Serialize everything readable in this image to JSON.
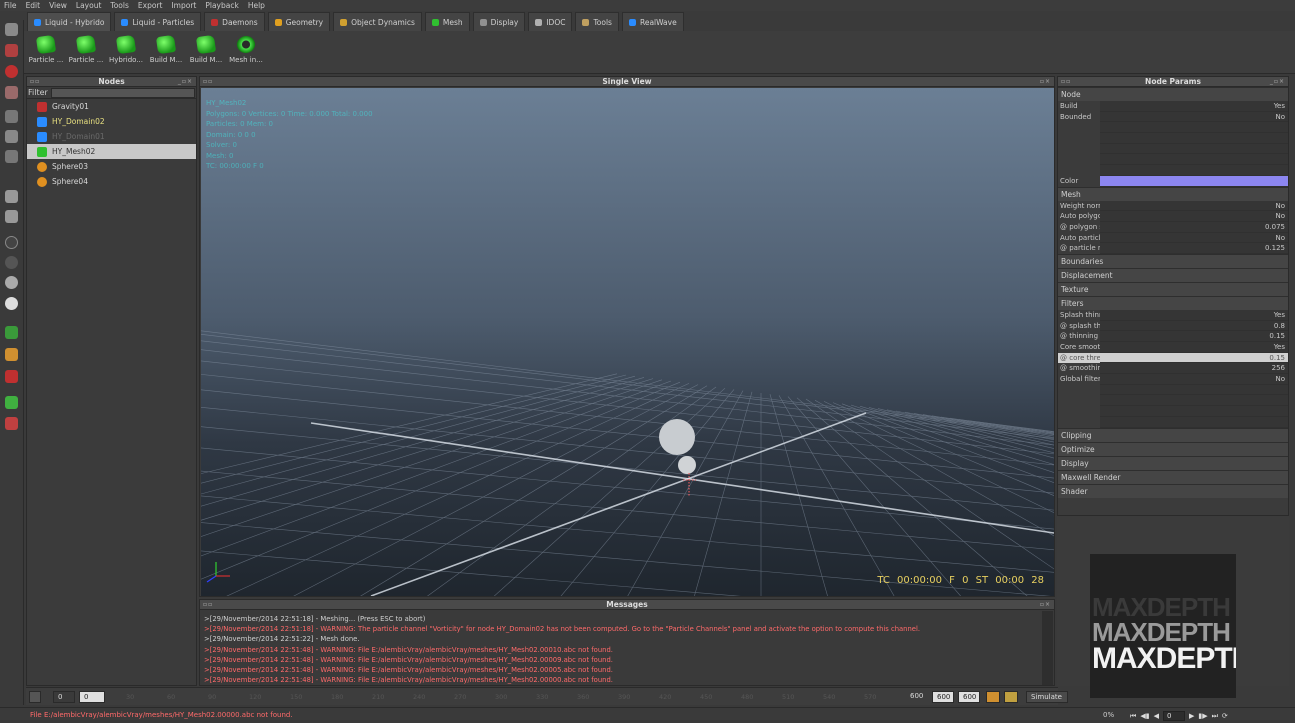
{
  "menu": [
    "File",
    "Edit",
    "View",
    "Layout",
    "Tools",
    "Export",
    "Import",
    "Playback",
    "Help"
  ],
  "tabs": [
    {
      "label": "Liquid - Hybrido",
      "color": "#2a8cff"
    },
    {
      "label": "Liquid - Particles",
      "color": "#2a8cff"
    },
    {
      "label": "Daemons",
      "color": "#c03030"
    },
    {
      "label": "Geometry",
      "color": "#e0a020"
    },
    {
      "label": "Object Dynamics",
      "color": "#d0a030"
    },
    {
      "label": "Mesh",
      "color": "#30c030"
    },
    {
      "label": "Display",
      "color": "#909090"
    },
    {
      "label": "IDOC",
      "color": "#b0b0b0"
    },
    {
      "label": "Tools",
      "color": "#c0a060"
    },
    {
      "label": "RealWave",
      "color": "#2a8cff"
    }
  ],
  "toolbar": [
    "Particle ...",
    "Particle ...",
    "Hybrido...",
    "Build M...",
    "Build M...",
    "Mesh in..."
  ],
  "nodes": {
    "title": "Nodes",
    "filter_label": "Filter",
    "filter_value": "",
    "items": [
      {
        "label": "Gravity01",
        "icon": "gravity-icon",
        "color": "#c03030"
      },
      {
        "label": "HY_Domain02",
        "icon": "domain-icon",
        "color": "#2a8cff"
      },
      {
        "label": "HY_Domain01",
        "icon": "domain-icon",
        "color": "#2a8cff"
      },
      {
        "label": "HY_Mesh02",
        "icon": "mesh-icon",
        "color": "#30c030"
      },
      {
        "label": "Sphere03",
        "icon": "sphere-icon",
        "color": "#e09020"
      },
      {
        "label": "Sphere04",
        "icon": "sphere-icon",
        "color": "#e09020"
      }
    ]
  },
  "view": {
    "title": "Single View",
    "hud": [
      "HY_Mesh02",
      "Polygons: 0 Vertices: 0 Time: 0.000 Total: 0.000",
      "Particles: 0 Mem: 0",
      "Domain: 0  0  0",
      "Solver: 0",
      "Mesh: 0",
      "TC: 00:00:00  F 0"
    ],
    "tc": "TC 00:00:00",
    "frame": "F 0",
    "st": "ST 00:00 28"
  },
  "messages": {
    "title": "Messages",
    "lines": [
      {
        "text": ">[29/November/2014 22:51:18] - Meshing... (Press ESC to abort)",
        "level": "info"
      },
      {
        "text": ">[29/November/2014 22:51:18] - WARNING: The particle channel \"Vorticity\" for node HY_Domain02 has not been computed. Go to the \"Particle Channels\" panel and activate the option to compute this channel.",
        "level": "warn"
      },
      {
        "text": ">[29/November/2014 22:51:22] - Mesh done.",
        "level": "info"
      },
      {
        "text": ">[29/November/2014 22:51:48] - WARNING: File E:/alembicVray/alembicVray/meshes/HY_Mesh02.00010.abc not found.",
        "level": "warn"
      },
      {
        "text": ">[29/November/2014 22:51:48] - WARNING: File E:/alembicVray/alembicVray/meshes/HY_Mesh02.00009.abc not found.",
        "level": "warn"
      },
      {
        "text": ">[29/November/2014 22:51:48] - WARNING: File E:/alembicVray/alembicVray/meshes/HY_Mesh02.00005.abc not found.",
        "level": "warn"
      },
      {
        "text": ">[29/November/2014 22:51:48] - WARNING: File E:/alembicVray/alembicVray/meshes/HY_Mesh02.00000.abc not found.",
        "level": "warn"
      }
    ]
  },
  "params": {
    "title": "Node Params",
    "node_section": "Node",
    "node_rows": [
      {
        "k": "Build",
        "v": "Yes"
      },
      {
        "k": "Bounded",
        "v": "No"
      },
      {
        "k": "",
        "v": "",
        "ghost": true
      },
      {
        "k": "",
        "v": "",
        "ghost": true
      },
      {
        "k": "",
        "v": "",
        "ghost": true
      },
      {
        "k": "",
        "v": "",
        "ghost": true
      },
      {
        "k": "",
        "v": "",
        "ghost": true
      },
      {
        "k": "Color",
        "v": "",
        "color": "#8c86f0"
      }
    ],
    "mesh_section": "Mesh",
    "mesh_rows": [
      {
        "k": "Weight normalization",
        "v": "No"
      },
      {
        "k": "Auto polygon size",
        "v": "No"
      },
      {
        "k": "@ polygon size",
        "v": "0.075"
      },
      {
        "k": "Auto particle radius",
        "v": "No"
      },
      {
        "k": "@ particle radius",
        "v": "0.125"
      }
    ],
    "mid_sections": [
      "Boundaries",
      "Displacement",
      "Texture"
    ],
    "filters_section": "Filters",
    "filter_rows": [
      {
        "k": "Splash thinning filter",
        "v": "Yes"
      },
      {
        "k": "@ splash threshold",
        "v": "0.8"
      },
      {
        "k": "@ thinning size",
        "v": "0.15"
      },
      {
        "k": "Core smoothing filter",
        "v": "Yes"
      },
      {
        "k": "@ core threshold",
        "v": "0.15",
        "hl": true
      },
      {
        "k": "@ smoothing steps",
        "v": "256"
      },
      {
        "k": "Global filter",
        "v": "No"
      },
      {
        "k": "",
        "v": "",
        "ghost": true
      },
      {
        "k": "",
        "v": "",
        "ghost": true
      },
      {
        "k": "",
        "v": "",
        "ghost": true
      },
      {
        "k": "",
        "v": "",
        "ghost": true
      }
    ],
    "end_sections": [
      "Clipping",
      "Optimize",
      "Display",
      "Maxwell Render",
      "Shader"
    ]
  },
  "logo": [
    "MAXDEPTH",
    "MAXDEPTH",
    "MAXDEPTH"
  ],
  "timeline": {
    "start": "0",
    "current": "0",
    "ticks": [
      "30",
      "60",
      "90",
      "120",
      "150",
      "180",
      "210",
      "240",
      "270",
      "300",
      "330",
      "360",
      "390",
      "420",
      "450",
      "480",
      "510",
      "540",
      "570"
    ],
    "end1": "600",
    "end2": "600",
    "end3": "600",
    "sim_label": "Simulate"
  },
  "status": {
    "text": "File E:/alembicVray/alembicVray/meshes/HY_Mesh02.00000.abc not found.",
    "percent": "0%",
    "frame": "0"
  }
}
